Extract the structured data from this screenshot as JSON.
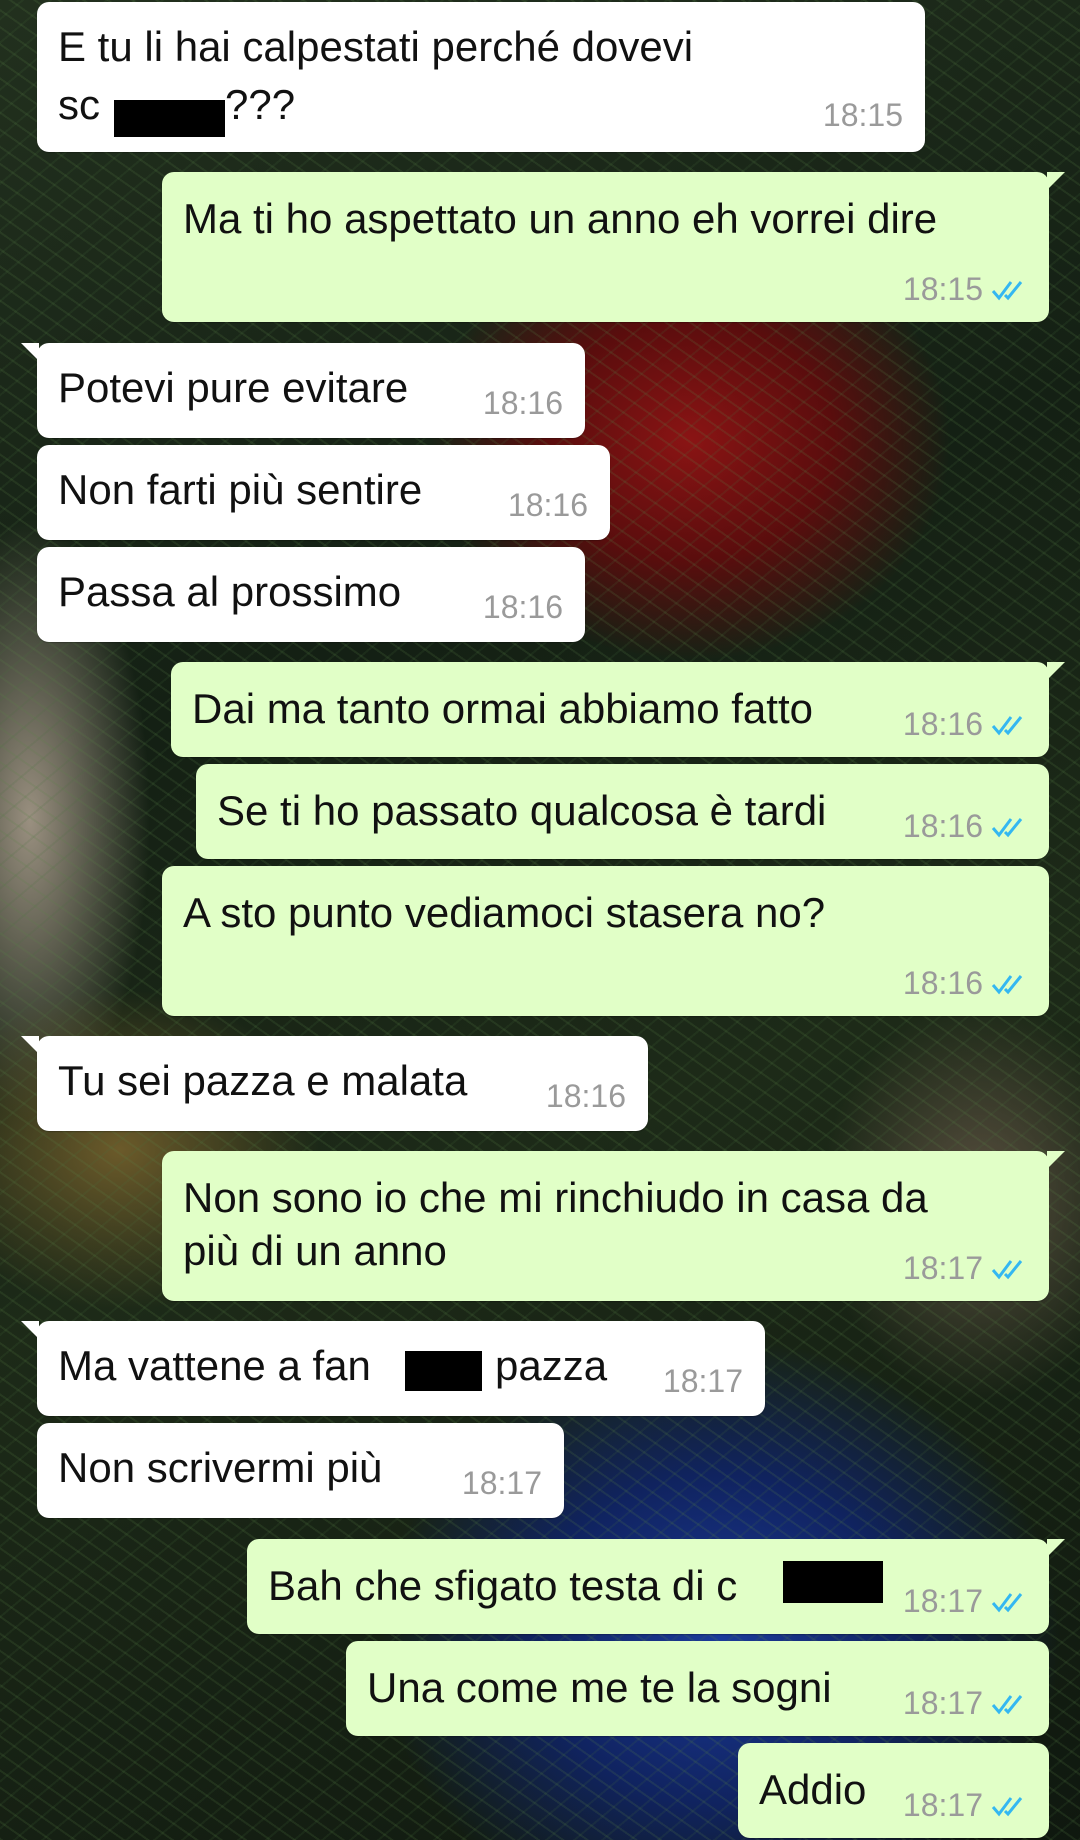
{
  "messages": [
    {
      "text": "E tu li hai calpestati perché dovevi",
      "text2": "sc",
      "text2b": "???",
      "time": "18:15"
    },
    {
      "text": "Ma ti ho aspettato un anno eh vorrei dire",
      "time": "18:15"
    },
    {
      "text": "Potevi pure evitare",
      "time": "18:16"
    },
    {
      "text": "Non farti più sentire",
      "time": "18:16"
    },
    {
      "text": "Passa al prossimo",
      "time": "18:16"
    },
    {
      "text": "Dai ma tanto ormai abbiamo fatto",
      "time": "18:16"
    },
    {
      "text": "Se ti ho passato qualcosa è tardi",
      "time": "18:16"
    },
    {
      "text": "A sto punto vediamoci stasera no?",
      "time": "18:16"
    },
    {
      "text": "Tu sei pazza e malata",
      "time": "18:16"
    },
    {
      "text": "Non sono io che mi rinchiudo in casa da",
      "text2": "più di un anno",
      "time": "18:17"
    },
    {
      "text": "Ma vattene a fan",
      "text2": "pazza",
      "time": "18:17"
    },
    {
      "text": "Non scrivermi più",
      "time": "18:17"
    },
    {
      "text": "Bah che sfigato testa di c",
      "time": "18:17"
    },
    {
      "text": "Una come me te la sogni",
      "time": "18:17"
    },
    {
      "text": "Addio",
      "time": "18:17"
    }
  ],
  "colors": {
    "incoming_bubble": "#ffffff",
    "outgoing_bubble": "#e1ffc7",
    "read_ticks": "#34b7f1",
    "timestamp": "#9a9a9a"
  },
  "icons": {
    "read_receipt": "double-check-icon"
  }
}
